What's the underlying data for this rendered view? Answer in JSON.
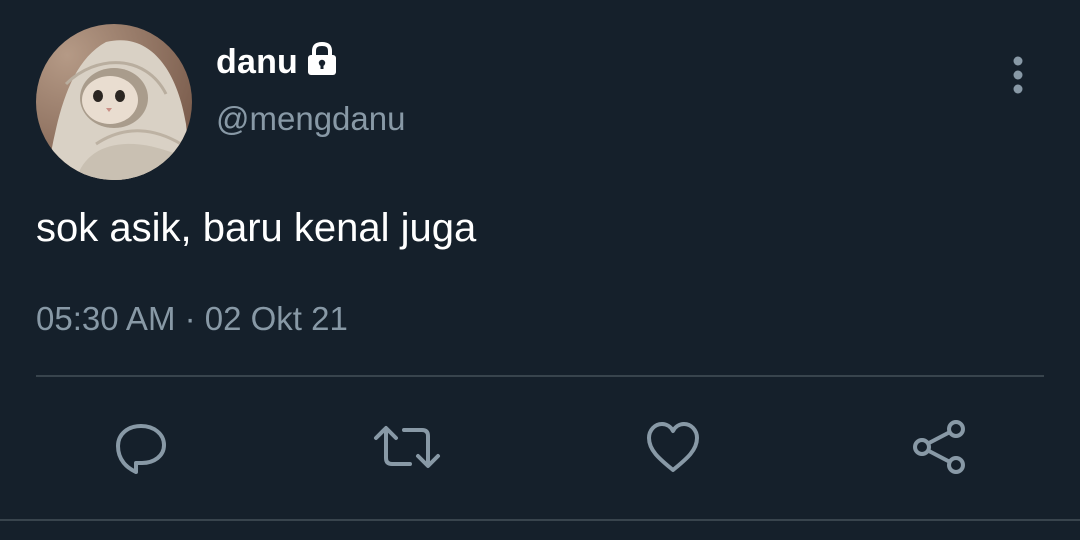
{
  "tweet": {
    "author": {
      "display_name": "danu",
      "handle": "@mengdanu",
      "protected_icon": "lock-icon",
      "avatar_icon": "cat-wrapped-in-blanket-avatar"
    },
    "text": "sok asik, baru kenal juga",
    "timestamp": "05:30 AM · 02 Okt 21",
    "menu_icon": "more-vertical-icon"
  },
  "actions": [
    {
      "name": "reply",
      "icon": "comment-icon"
    },
    {
      "name": "retweet",
      "icon": "retweet-icon"
    },
    {
      "name": "like",
      "icon": "heart-icon"
    },
    {
      "name": "share",
      "icon": "share-icon"
    }
  ],
  "colors": {
    "background": "#15202b",
    "primary_text": "#ffffff",
    "secondary_text": "#8899a6",
    "divider": "#38444d"
  }
}
